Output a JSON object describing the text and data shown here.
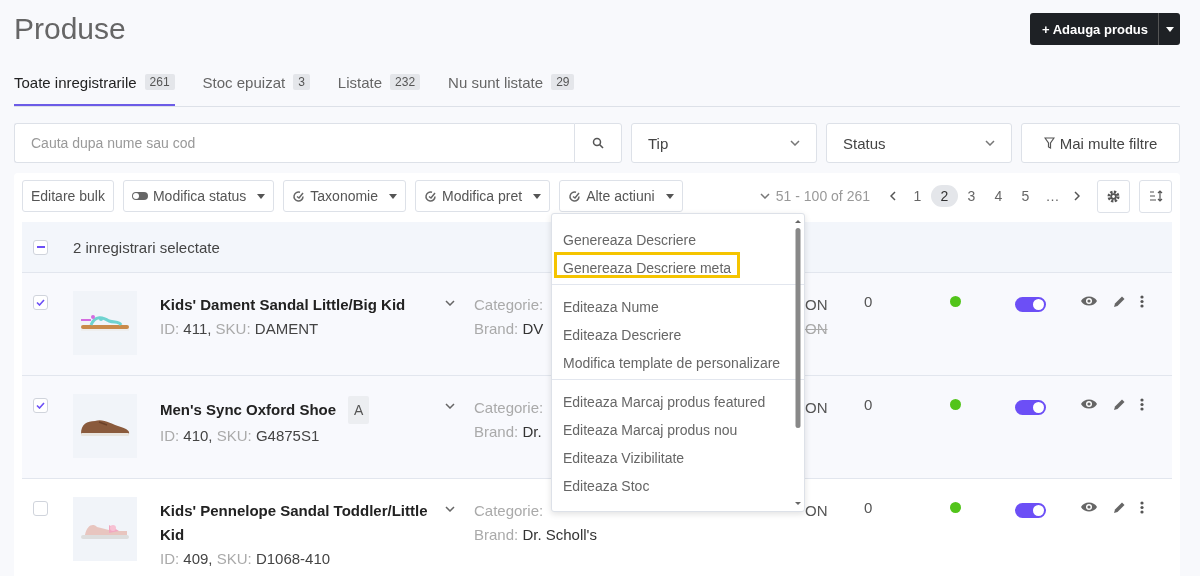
{
  "page_title": "Produse",
  "add_button": {
    "label": "+ Adauga produs"
  },
  "tabs": [
    {
      "label": "Toate inregistrarile",
      "count": "261",
      "selected": true
    },
    {
      "label": "Stoc epuizat",
      "count": "3",
      "selected": false
    },
    {
      "label": "Listate",
      "count": "232",
      "selected": false
    },
    {
      "label": "Nu sunt listate",
      "count": "29",
      "selected": false
    }
  ],
  "search": {
    "placeholder": "Cauta dupa nume sau cod"
  },
  "filters": [
    {
      "kind": "select",
      "label": "Tip"
    },
    {
      "kind": "select",
      "label": "Status"
    },
    {
      "kind": "button",
      "label": "Mai multe filtre"
    }
  ],
  "toolbar": [
    {
      "kind": "plain",
      "label": "Editare bulk"
    },
    {
      "kind": "toggle",
      "label": "Modifica status"
    },
    {
      "kind": "check",
      "label": "Taxonomie"
    },
    {
      "kind": "check",
      "label": "Modifica pret"
    },
    {
      "kind": "check",
      "label": "Alte actiuni"
    }
  ],
  "pagination": {
    "range": "51 - 100 of 261",
    "pages": [
      {
        "label": "1",
        "selected": false
      },
      {
        "label": "2",
        "selected": true
      },
      {
        "label": "3",
        "selected": false
      },
      {
        "label": "4",
        "selected": false
      },
      {
        "label": "5",
        "selected": false
      },
      {
        "label": "…",
        "selected": false
      }
    ]
  },
  "selection": {
    "label": "2 inregistrari selectate",
    "indeterminate": true
  },
  "rows": [
    {
      "checked": true,
      "name": "Kids' Dament Sandal Little/Big Kid",
      "id_label": "ID:",
      "id": "411,",
      "sku_label": "SKU:",
      "sku": "DAMENT",
      "category_label": "Categorie:",
      "brand_label": "Brand:",
      "brand": "DV",
      "price": "ON",
      "old_price": "ON",
      "stock": "0",
      "published": true,
      "active": true
    },
    {
      "checked": true,
      "name": "Men's Sync Oxford Shoe",
      "badge": "A",
      "id_label": "ID:",
      "id": "410,",
      "sku_label": "SKU:",
      "sku": "G4875S1",
      "category_label": "Categorie:",
      "brand_label": "Brand:",
      "brand": "Dr.",
      "price": "ON",
      "stock": "0",
      "published": true,
      "active": true
    },
    {
      "checked": false,
      "name": "Kids' Pennelope Sandal Toddler/Little Kid",
      "id_label": "ID:",
      "id": "409,",
      "sku_label": "SKU:",
      "sku": "D1068-410",
      "category_label": "Categorie:",
      "brand_label": "Brand:",
      "brand": "Dr. Scholl's",
      "price": "ON",
      "stock": "0",
      "published": true,
      "active": true
    }
  ],
  "menu": {
    "groups": [
      [
        {
          "label": "Genereaza Descriere",
          "selected": false
        },
        {
          "label": "Genereaza Descriere meta",
          "selected": true
        }
      ],
      [
        {
          "label": "Editeaza Nume",
          "selected": false
        },
        {
          "label": "Editeaza Descriere",
          "selected": false
        },
        {
          "label": "Modifica template de personalizare",
          "selected": false
        }
      ],
      [
        {
          "label": "Editeaza Marcaj produs featured",
          "selected": false
        },
        {
          "label": "Editeaza Marcaj produs nou",
          "selected": false
        },
        {
          "label": "Editeaza Vizibilitate",
          "selected": false
        },
        {
          "label": "Editeaza Stoc",
          "selected": false
        }
      ]
    ]
  }
}
